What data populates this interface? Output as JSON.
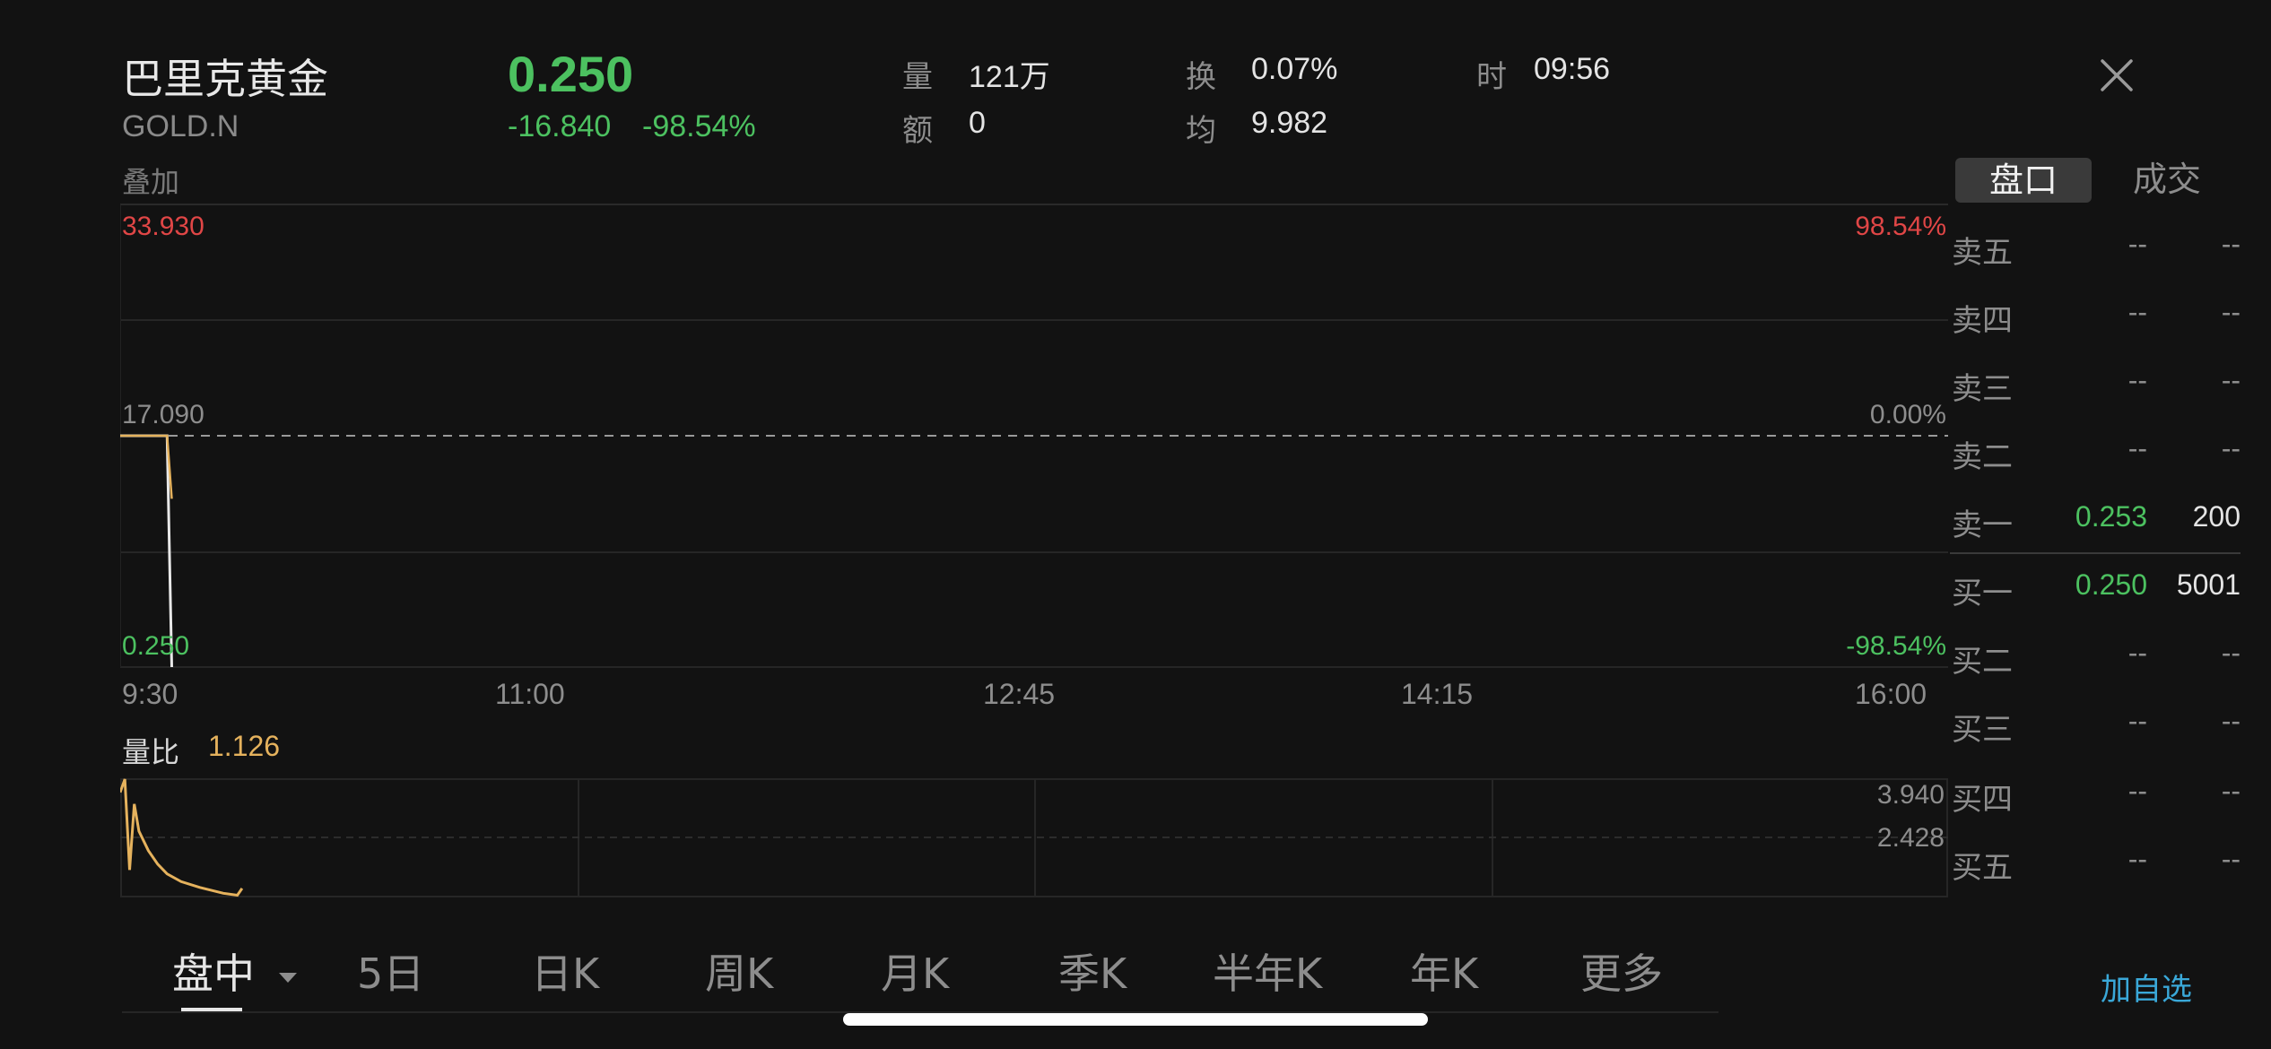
{
  "header": {
    "name": "巴里克黄金",
    "code": "GOLD.N",
    "overlay": "叠加",
    "price": "0.250",
    "change": "-16.840",
    "change_pct": "-98.54%",
    "stats": {
      "volume_label": "量",
      "volume": "121万",
      "amount_label": "额",
      "amount": "0",
      "turnover_label": "换",
      "turnover": "0.07%",
      "avg_label": "均",
      "avg": "9.982",
      "time_label": "时",
      "time": "09:56"
    },
    "close_icon": "close-icon"
  },
  "chart": {
    "max_price": "33.930",
    "mid_price": "17.090",
    "min_price": "0.250",
    "max_pct": "98.54%",
    "mid_pct": "0.00%",
    "min_pct": "-98.54%",
    "time_ticks": [
      "9:30",
      "11:00",
      "12:45",
      "14:15",
      "16:00"
    ],
    "volume_ratio_label": "量比",
    "volume_ratio": "1.126",
    "vr_axis_top": "3.940",
    "vr_axis_mid": "2.428"
  },
  "chart_data": [
    {
      "type": "line",
      "title": "",
      "x_ticks": [
        "9:30",
        "11:00",
        "12:45",
        "14:15",
        "16:00"
      ],
      "ylim": [
        0.25,
        33.93
      ],
      "reference": 17.09,
      "series": [
        {
          "color": "#e8e8e8",
          "x": [
            "9:30",
            "9:33",
            "9:36",
            "9:39",
            "9:40",
            "9:41"
          ],
          "values": [
            17.09,
            17.09,
            17.09,
            17.09,
            17.09,
            0.25
          ]
        },
        {
          "color": "#e5b25d",
          "x": [
            "9:30",
            "9:33",
            "9:36",
            "9:39",
            "9:40",
            "9:41"
          ],
          "values": [
            17.09,
            17.09,
            17.09,
            17.09,
            17.09,
            12.5
          ]
        }
      ]
    },
    {
      "type": "line",
      "title": "",
      "ylim": [
        0.915,
        3.94
      ],
      "y_ticks": [
        3.94,
        2.428
      ],
      "series": [
        {
          "color": "#e5b25d",
          "x": [
            "9:30",
            "9:31",
            "9:32",
            "9:33",
            "9:34",
            "9:36",
            "9:38",
            "9:40",
            "9:43",
            "9:47",
            "9:52",
            "9:55",
            "9:56"
          ],
          "values": [
            3.6,
            3.94,
            1.6,
            3.3,
            2.6,
            2.1,
            1.75,
            1.5,
            1.3,
            1.15,
            1.0,
            0.95,
            1.126
          ]
        }
      ]
    }
  ],
  "orderbook": {
    "tabs": [
      "盘口",
      "成交"
    ],
    "rows": [
      {
        "label": "卖五",
        "price": "--",
        "vol": "--"
      },
      {
        "label": "卖四",
        "price": "--",
        "vol": "--"
      },
      {
        "label": "卖三",
        "price": "--",
        "vol": "--"
      },
      {
        "label": "卖二",
        "price": "--",
        "vol": "--"
      },
      {
        "label": "卖一",
        "price": "0.253",
        "vol": "200"
      },
      {
        "label": "买一",
        "price": "0.250",
        "vol": "5001"
      },
      {
        "label": "买二",
        "price": "--",
        "vol": "--"
      },
      {
        "label": "买三",
        "price": "--",
        "vol": "--"
      },
      {
        "label": "买四",
        "price": "--",
        "vol": "--"
      },
      {
        "label": "买五",
        "price": "--",
        "vol": "--"
      }
    ]
  },
  "period_tabs": [
    "盘中",
    "5日",
    "日K",
    "周K",
    "月K",
    "季K",
    "半年K",
    "年K",
    "更多"
  ],
  "add_watchlist": "加自选",
  "colors": {
    "up": "#e04646",
    "down": "#4cc160",
    "accent": "#3aa8d8",
    "gold": "#e5b25d"
  }
}
